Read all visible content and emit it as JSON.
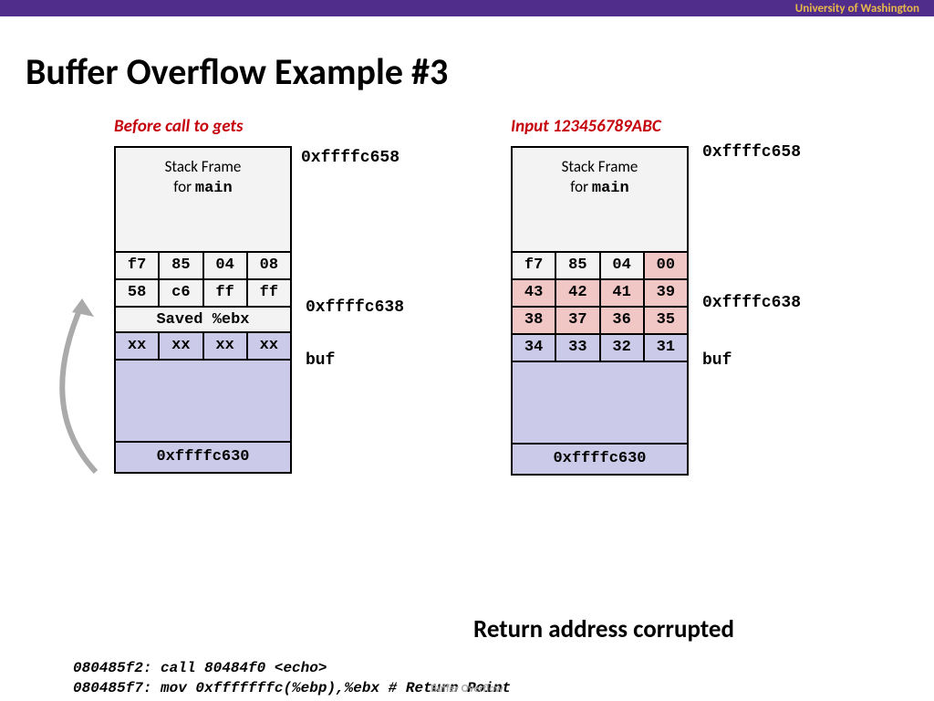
{
  "header": {
    "org": "University of Washington"
  },
  "title": "Buffer Overflow Example #3",
  "left": {
    "subtitle": "Before call to gets",
    "sframe_l1": "Stack Frame",
    "sframe_l2_pre": "for ",
    "sframe_l2_mono": "main",
    "row1": [
      "f7",
      "85",
      "04",
      "08"
    ],
    "row2": [
      "58",
      "c6",
      "ff",
      "ff"
    ],
    "saved_ebx": "Saved %ebx",
    "row_buf": [
      "xx",
      "xx",
      "xx",
      "xx"
    ],
    "bottom": "0xffffc630",
    "addr_top": "0xffffc658",
    "addr_mid": "0xffffc638",
    "addr_buf": "buf"
  },
  "right": {
    "subtitle": "Input 123456789ABC",
    "sframe_l1": "Stack Frame",
    "sframe_l2_pre": "for ",
    "sframe_l2_mono": "main",
    "row1": [
      "f7",
      "85",
      "04",
      "00"
    ],
    "row2": [
      "43",
      "42",
      "41",
      "39"
    ],
    "row3": [
      "38",
      "37",
      "36",
      "35"
    ],
    "row_buf": [
      "34",
      "33",
      "32",
      "31"
    ],
    "bottom": "0xffffc630",
    "addr_top": "0xffffc658",
    "addr_mid": "0xffffc638",
    "addr_buf": "buf"
  },
  "retcorrupt": "Return address corrupted",
  "code": {
    "l1": "080485f2: call 80484f0 <echo>",
    "l2": "080485f7: mov  0xfffffffc(%ebp),%ebx # Return Point"
  },
  "footer": "Buffer Overflow"
}
